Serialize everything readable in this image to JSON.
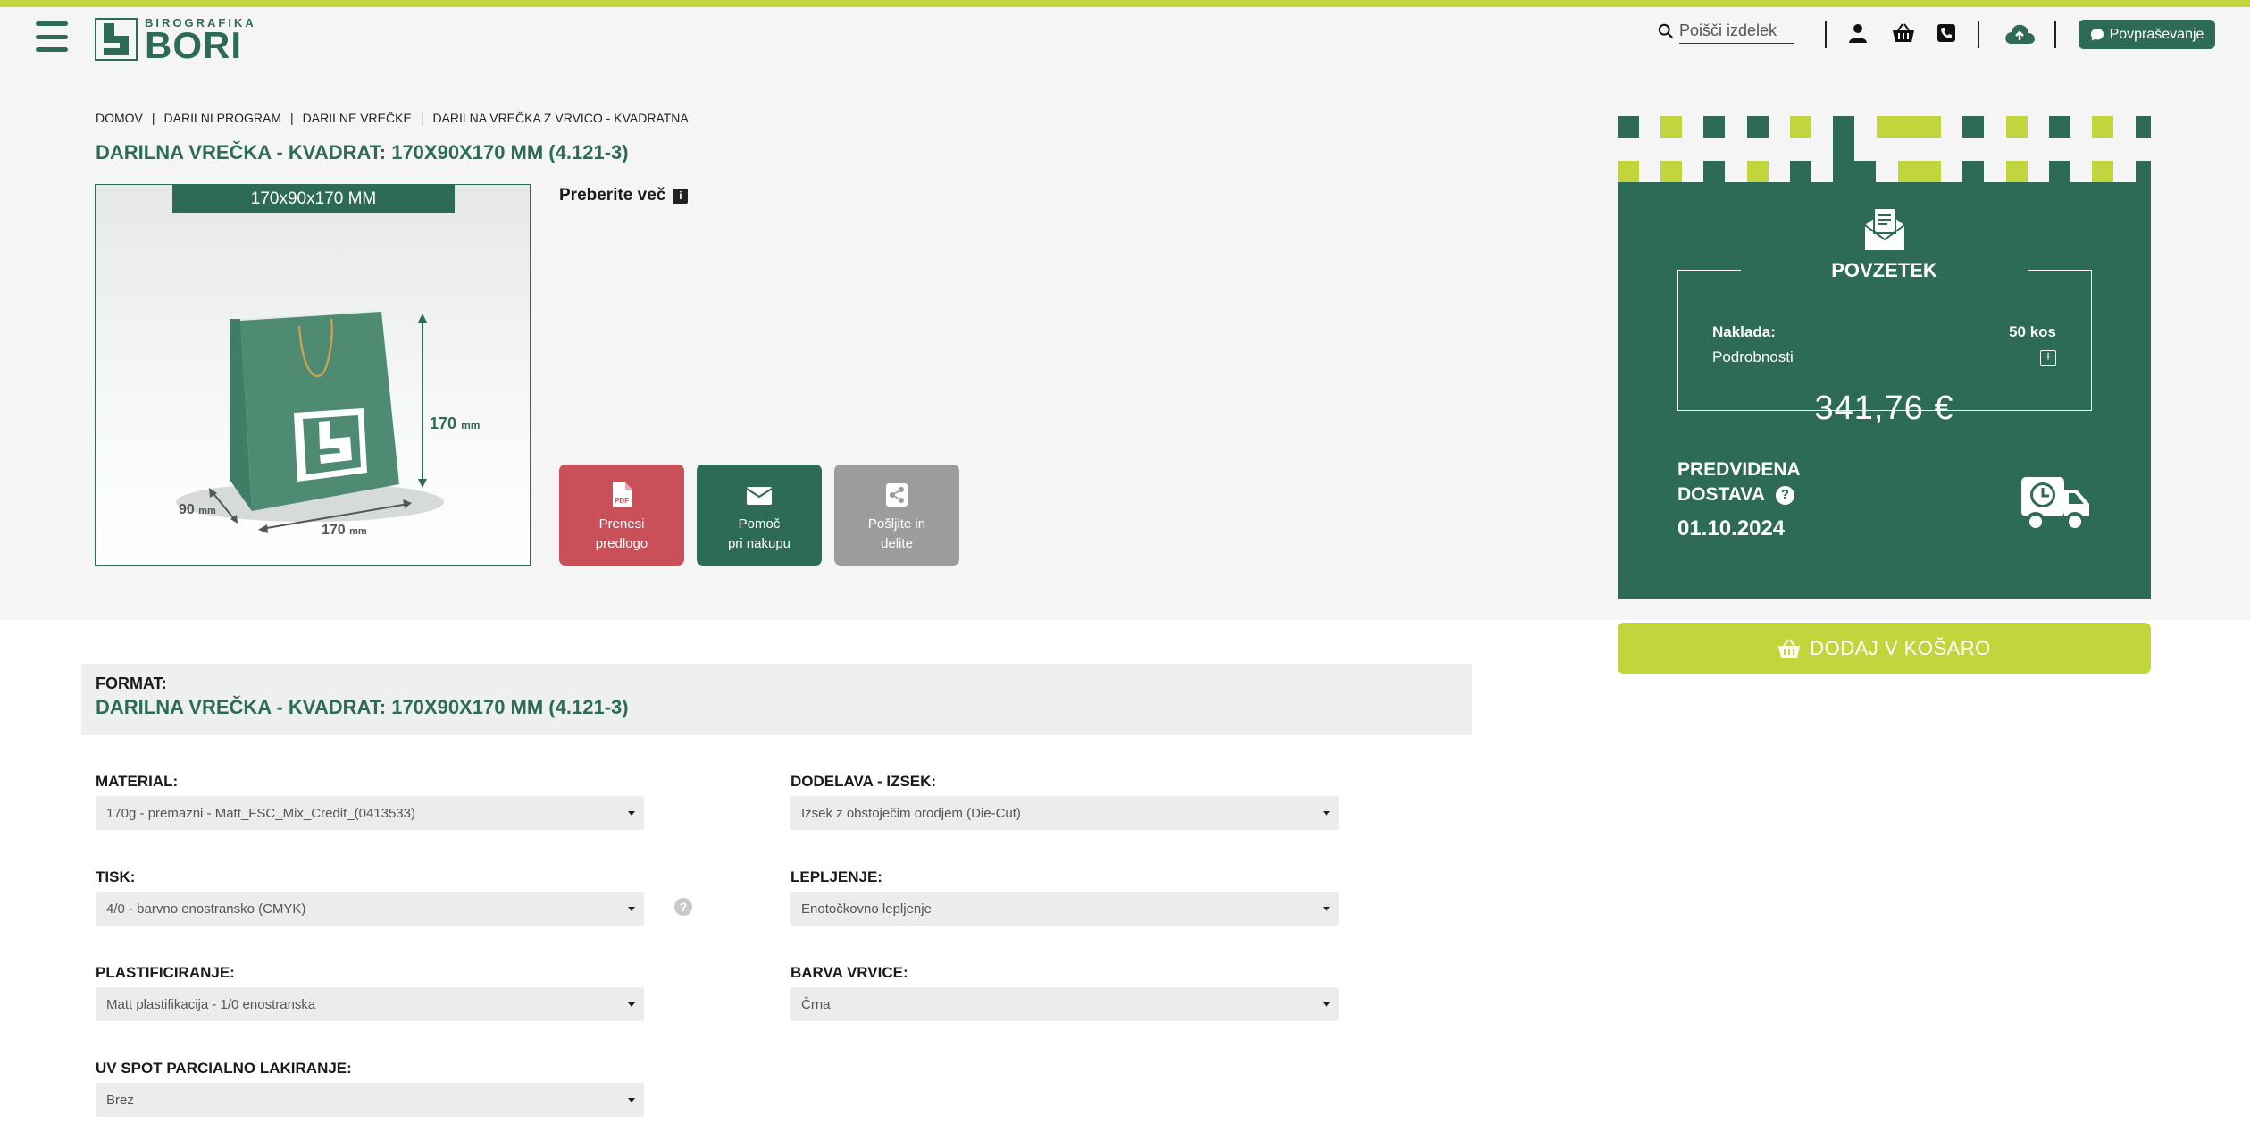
{
  "header": {
    "logo_small": "BIROGRAFIKA",
    "logo_big": "BORI",
    "search_placeholder": "Poišči izdelek",
    "inquiry_label": "Povpraševanje",
    "icons": [
      "menu-icon",
      "search-icon",
      "user-icon",
      "cart-icon",
      "phone-icon",
      "cloud-upload-icon",
      "chat-icon"
    ]
  },
  "breadcrumb": [
    "DOMOV",
    "DARILNI PROGRAM",
    "DARILNE VREČKE",
    "DARILNA VREČKA Z VRVICO - KVADRATNA"
  ],
  "product": {
    "title": "DARILNA VREČKA - KVADRAT: 170X90X170 MM (4.121-3)",
    "size_label": "170x90x170 MM",
    "dim_height": "170",
    "dim_depth": "90",
    "dim_width": "170",
    "dim_unit": "mm",
    "more_label": "Preberite več"
  },
  "actions": {
    "download": {
      "line1": "Prenesi",
      "line2": "predlogo",
      "badge": "PDF"
    },
    "help": {
      "line1": "Pomoč",
      "line2": "pri nakupu"
    },
    "share": {
      "line1": "Pošljite in",
      "line2": "delite"
    }
  },
  "summary": {
    "title": "POVZETEK",
    "qty_label": "Naklada:",
    "qty_value": "50 kos",
    "details_label": "Podrobnosti",
    "price": "341,76 €",
    "delivery_line1": "PREDVIDENA",
    "delivery_line2": "DOSTAVA",
    "delivery_date": "01.10.2024",
    "add_to_cart": "DODAJ V KOŠARO"
  },
  "format": {
    "label": "FORMAT:",
    "value": "DARILNA VREČKA - KVADRAT: 170X90X170 MM (4.121-3)"
  },
  "options": {
    "material": {
      "label": "MATERIAL:",
      "value": "170g - premazni - Matt_FSC_Mix_Credit_(0413533)"
    },
    "finishing": {
      "label": "DODELAVA - IZSEK:",
      "value": "Izsek z obstoječim orodjem (Die-Cut)"
    },
    "print": {
      "label": "TISK:",
      "value": "4/0 - barvno enostransko (CMYK)"
    },
    "gluing": {
      "label": "LEPLJENJE:",
      "value": "Enotočkovno lepljenje"
    },
    "lamination": {
      "label": "PLASTIFICIRANJE:",
      "value": "Matt plastifikacija - 1/0 enostranska"
    },
    "cord_color": {
      "label": "BARVA VRVICE:",
      "value": "Črna"
    },
    "uv_spot": {
      "label": "UV SPOT PARCIALNO LAKIRANJE:",
      "value": "Brez"
    }
  },
  "colors": {
    "green": "#2e6b57",
    "lime": "#c3d53c",
    "red": "#c95058",
    "gray": "#9a9c9e"
  }
}
